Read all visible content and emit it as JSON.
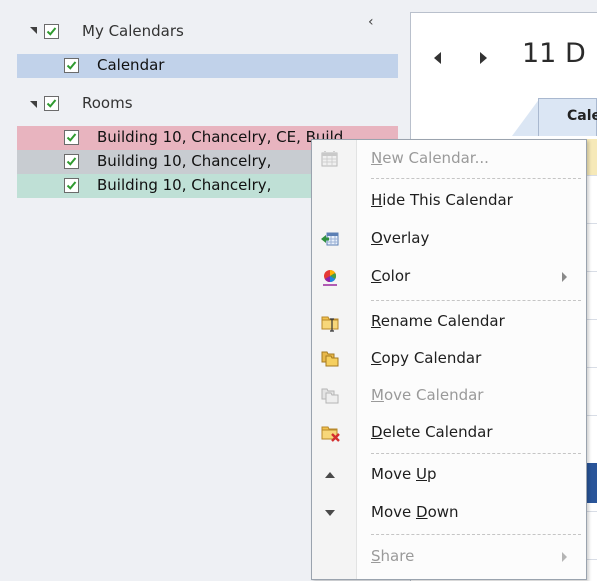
{
  "nav": {
    "groups": [
      {
        "label": "My Calendars",
        "calendars": [
          {
            "label": "Calendar",
            "color": "#c1d2ea"
          }
        ]
      },
      {
        "label": "Rooms",
        "calendars": [
          {
            "label": "Building 10, Chancelry, CE, Build",
            "color": "#e8b4bf"
          },
          {
            "label": "Building 10, Chancelry,",
            "color": "#c8ccd1"
          },
          {
            "label": "Building 10, Chancelry,",
            "color": "#bfe0d6"
          }
        ]
      }
    ]
  },
  "calendar_pane": {
    "date_title": "11 D",
    "active_tab": "Caler"
  },
  "context_menu": {
    "items": [
      {
        "label_pre": "",
        "label_key": "N",
        "label_post": "ew Calendar...",
        "icon": "new-calendar-icon",
        "enabled": false,
        "submenu": false
      },
      {
        "label_pre": "",
        "label_key": "H",
        "label_post": "ide This Calendar",
        "icon": "none",
        "enabled": true,
        "submenu": false
      },
      {
        "label_pre": "",
        "label_key": "O",
        "label_post": "verlay",
        "icon": "overlay-icon",
        "enabled": true,
        "submenu": false
      },
      {
        "label_pre": "",
        "label_key": "C",
        "label_post": "olor",
        "icon": "color-icon",
        "enabled": true,
        "submenu": true
      },
      {
        "label_pre": "",
        "label_key": "R",
        "label_post": "ename Calendar",
        "icon": "rename-calendar-icon",
        "enabled": true,
        "submenu": false
      },
      {
        "label_pre": "",
        "label_key": "C",
        "label_post": "opy Calendar",
        "icon": "copy-calendar-icon",
        "enabled": true,
        "submenu": false
      },
      {
        "label_pre": "",
        "label_key": "M",
        "label_post": "ove Calendar",
        "icon": "move-calendar-icon",
        "enabled": false,
        "submenu": false
      },
      {
        "label_pre": "",
        "label_key": "D",
        "label_post": "elete Calendar",
        "icon": "delete-calendar-icon",
        "enabled": true,
        "submenu": false
      },
      {
        "label_pre": "Move ",
        "label_key": "U",
        "label_post": "p",
        "icon": "move-up-icon",
        "enabled": true,
        "submenu": false
      },
      {
        "label_pre": "Move ",
        "label_key": "D",
        "label_post": "own",
        "icon": "move-down-icon",
        "enabled": true,
        "submenu": false
      },
      {
        "label_pre": "",
        "label_key": "S",
        "label_post": "hare",
        "icon": "share-icon",
        "enabled": false,
        "submenu": true
      }
    ]
  }
}
